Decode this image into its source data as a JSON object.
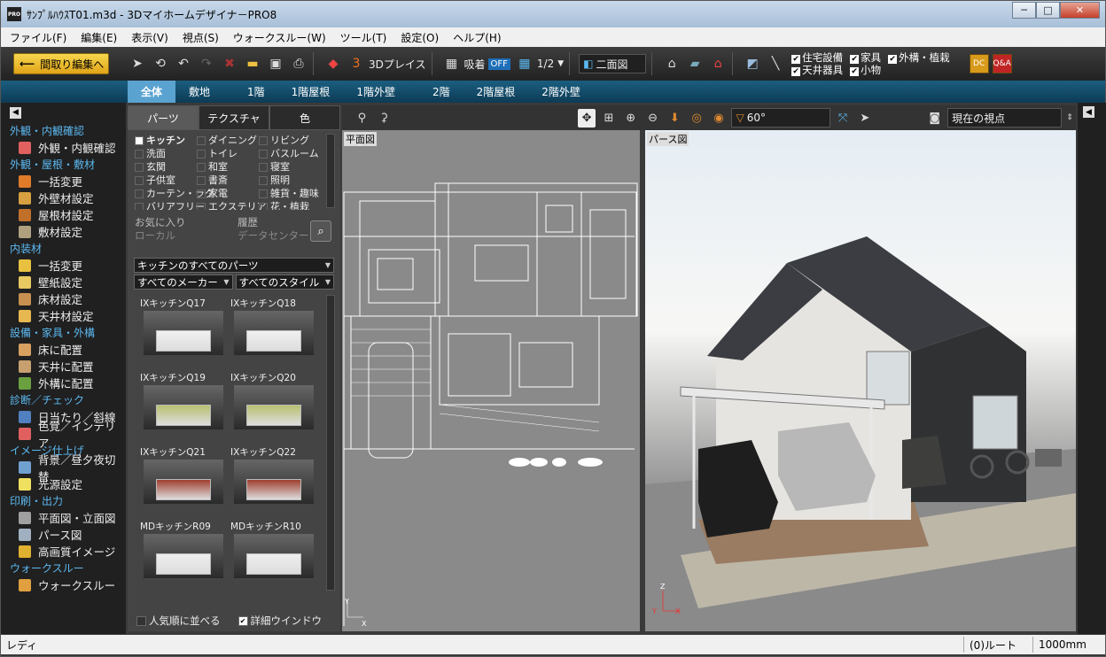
{
  "window": {
    "title": "ｻﾝﾌﾟﾙﾊｳｽT01.m3d - 3Dマイホームデザイナ－PRO8",
    "icon_text": "PRO",
    "minimize": "─",
    "maximize": "□",
    "close": "✕"
  },
  "menu": [
    "ファイル(F)",
    "編集(E)",
    "表示(V)",
    "視点(S)",
    "ウォークスルー(W)",
    "ツール(T)",
    "設定(O)",
    "ヘルプ(H)"
  ],
  "toolbar": {
    "back_label": "間取り編集へ",
    "d3_label": "3Dプレイス",
    "snap_label": "吸着",
    "snap_state": "OFF",
    "grid_label": "1/2",
    "view_mode": "二面図",
    "checks": [
      "住宅設備",
      "家具",
      "外構・植栽",
      "天井器具",
      "小物"
    ],
    "dc": "DC",
    "qa": "Q&A"
  },
  "floor_tabs": [
    "全体",
    "敷地",
    "1階",
    "1階屋根",
    "1階外壁",
    "2階",
    "2階屋根",
    "2階外壁"
  ],
  "sidebar": {
    "toggle": "◀",
    "sections": [
      {
        "title": "外観・内観確認",
        "items": [
          {
            "label": "外観・内観確認",
            "color": "#e06060"
          }
        ]
      },
      {
        "title": "外観・屋根・敷材",
        "items": [
          {
            "label": "一括変更",
            "color": "#e07b2a"
          },
          {
            "label": "外壁材設定",
            "color": "#d8a040"
          },
          {
            "label": "屋根材設定",
            "color": "#c0702a"
          },
          {
            "label": "敷材設定",
            "color": "#b0a080"
          }
        ]
      },
      {
        "title": "内装材",
        "items": [
          {
            "label": "一括変更",
            "color": "#e8c040"
          },
          {
            "label": "壁紙設定",
            "color": "#e8c860"
          },
          {
            "label": "床材設定",
            "color": "#c89050"
          },
          {
            "label": "天井材設定",
            "color": "#e8b850"
          }
        ]
      },
      {
        "title": "設備・家具・外構",
        "items": [
          {
            "label": "床に配置",
            "color": "#d8a060"
          },
          {
            "label": "天井に配置",
            "color": "#c8a070"
          },
          {
            "label": "外構に配置",
            "color": "#6aa040"
          }
        ]
      },
      {
        "title": "診断／チェック",
        "items": [
          {
            "label": "日当たり／斜線",
            "color": "#5080c0"
          },
          {
            "label": "色覚／インテリア",
            "color": "#e06060"
          }
        ]
      },
      {
        "title": "イメージ仕上げ",
        "items": [
          {
            "label": "背景／昼夕夜切替",
            "color": "#70a0d0"
          },
          {
            "label": "光源設定",
            "color": "#f0e060"
          }
        ]
      },
      {
        "title": "印刷・出力",
        "items": [
          {
            "label": "平面図・立面図",
            "color": "#a0a0a0"
          },
          {
            "label": "パース図",
            "color": "#a0b0c0"
          },
          {
            "label": "高画質イメージ",
            "color": "#e0b030"
          }
        ]
      },
      {
        "title": "ウォークスルー",
        "items": [
          {
            "label": "ウォークスルー",
            "color": "#e0a040"
          }
        ]
      }
    ]
  },
  "parts": {
    "tabs": [
      "パーツ",
      "テクスチャ",
      "色"
    ],
    "categories": [
      "キッチン",
      "ダイニング",
      "リビング",
      "洗面",
      "トイレ",
      "バスルーム",
      "玄関",
      "和室",
      "寝室",
      "子供室",
      "書斎",
      "照明",
      "カーテン・ラグ",
      "家電",
      "雑貨・趣味",
      "バリアフリー",
      "エクステリア",
      "花・植栽"
    ],
    "fav": "お気に入り",
    "history": "履歴",
    "local": "ローカル",
    "datacenter": "データセンター",
    "select_all": "キッチンのすべてのパーツ",
    "maker": "すべてのメーカー",
    "style": "すべてのスタイル",
    "items": [
      {
        "name": "IXキッチンQ17",
        "color": "#f0f0f0"
      },
      {
        "name": "IXキッチンQ18",
        "color": "#f0f0f0"
      },
      {
        "name": "IXキッチンQ19",
        "color": "#b8c070"
      },
      {
        "name": "IXキッチンQ20",
        "color": "#b8c070"
      },
      {
        "name": "IXキッチンQ21",
        "color": "#a04030"
      },
      {
        "name": "IXキッチンQ22",
        "color": "#a04030"
      },
      {
        "name": "MDキッチンR09",
        "color": "#eeeeee"
      },
      {
        "name": "MDキッチンR10",
        "color": "#eeeeee"
      }
    ],
    "sort_label": "人気順に並べる",
    "detail_label": "詳細ウインドウ"
  },
  "views": {
    "plan_label": "平面図",
    "pers_label": "パース図",
    "angle": "60°",
    "viewpoint": "現在の視点"
  },
  "status": {
    "text": "レディ",
    "route": "(0)ルート",
    "scale": "1000mm"
  }
}
